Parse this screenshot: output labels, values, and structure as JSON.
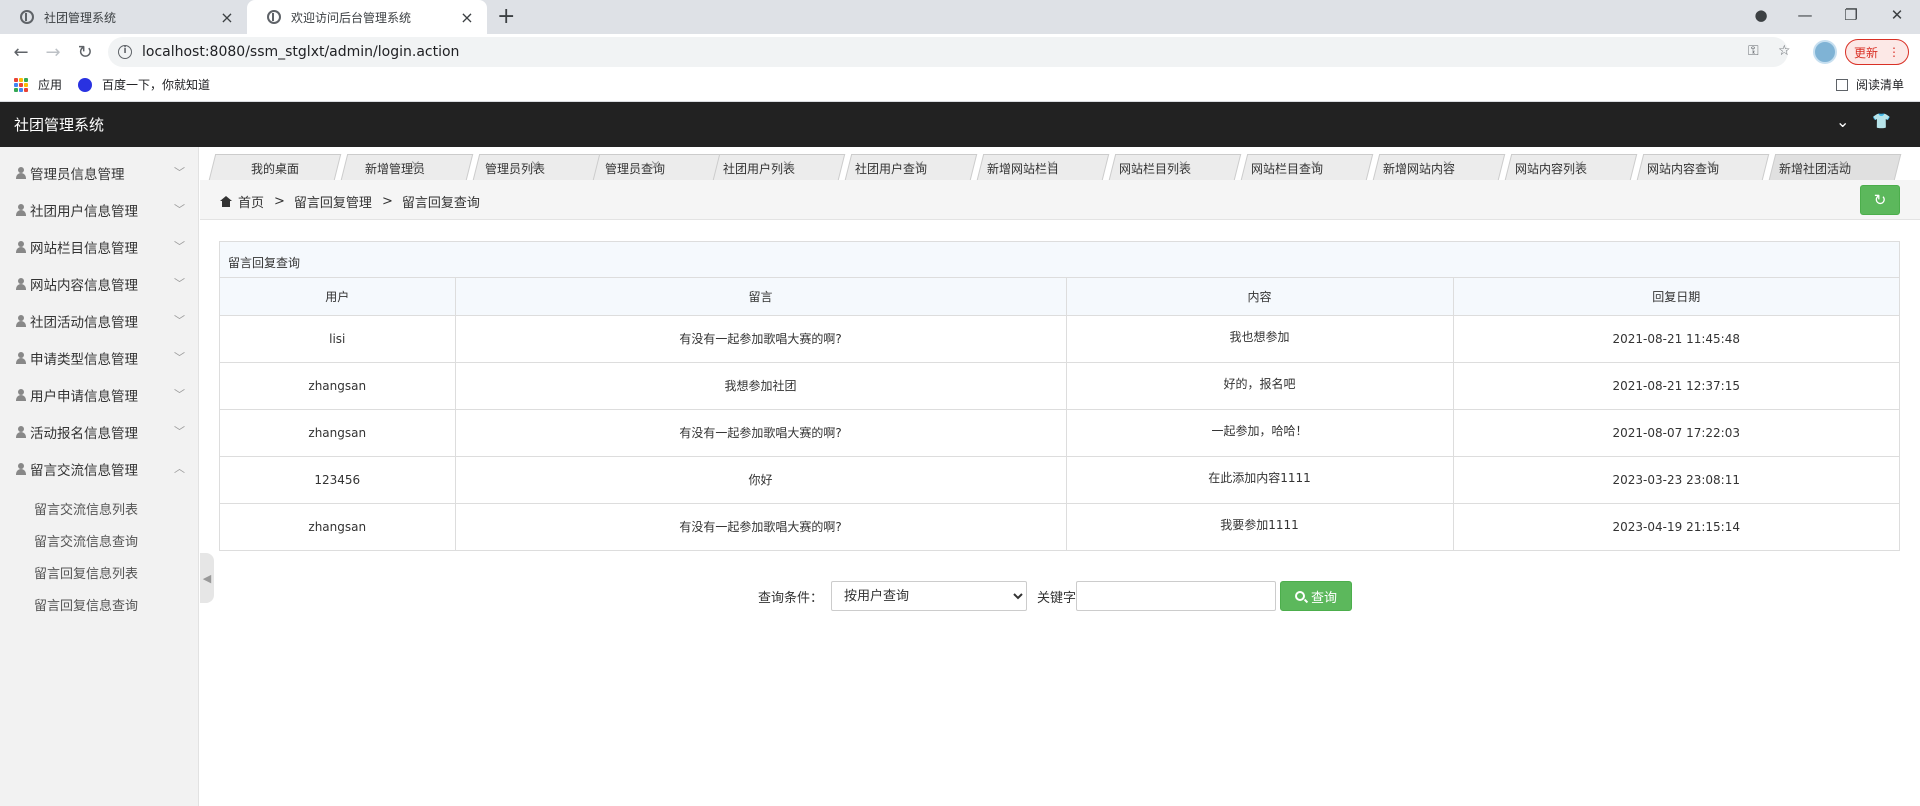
{
  "browser": {
    "tabs": [
      {
        "title": "社团管理系统"
      },
      {
        "title": "欢迎访问后台管理系统"
      }
    ],
    "url": "localhost:8080/ssm_stglxt/admin/login.action",
    "update_label": "更新",
    "bookmarks": [
      {
        "label": "应用"
      },
      {
        "label": "百度一下，你就知道"
      }
    ],
    "reading_list": "阅读清单"
  },
  "app": {
    "title": "社团管理系统"
  },
  "sidebar": {
    "items": [
      {
        "label": "管理员信息管理"
      },
      {
        "label": "社团用户信息管理"
      },
      {
        "label": "网站栏目信息管理"
      },
      {
        "label": "网站内容信息管理"
      },
      {
        "label": "社团活动信息管理"
      },
      {
        "label": "申请类型信息管理"
      },
      {
        "label": "用户申请信息管理"
      },
      {
        "label": "活动报名信息管理"
      },
      {
        "label": "留言交流信息管理"
      }
    ],
    "subitems": [
      {
        "label": "留言交流信息列表"
      },
      {
        "label": "留言交流信息查询"
      },
      {
        "label": "留言回复信息列表"
      },
      {
        "label": "留言回复信息查询"
      }
    ]
  },
  "page_tabs": [
    {
      "label": "我的桌面"
    },
    {
      "label": "新增管理员"
    },
    {
      "label": "管理员列表"
    },
    {
      "label": "管理员查询"
    },
    {
      "label": "社团用户列表"
    },
    {
      "label": "社团用户查询"
    },
    {
      "label": "新增网站栏目"
    },
    {
      "label": "网站栏目列表"
    },
    {
      "label": "网站栏目查询"
    },
    {
      "label": "新增网站内容"
    },
    {
      "label": "网站内容列表"
    },
    {
      "label": "网站内容查询"
    },
    {
      "label": "新增社团活动"
    }
  ],
  "breadcrumb": {
    "home": "首页",
    "sep": ">",
    "level1": "留言回复管理",
    "level2": "留言回复查询"
  },
  "panel": {
    "title": "留言回复查询",
    "columns": [
      "用户",
      "留言",
      "内容",
      "回复日期"
    ],
    "rows": [
      {
        "user": "lisi",
        "message": "有没有一起参加歌唱大赛的啊?",
        "content": "我也想参加",
        "date": "2021-08-21 11:45:48"
      },
      {
        "user": "zhangsan",
        "message": "我想参加社团",
        "content": "好的，报名吧",
        "date": "2021-08-21 12:37:15"
      },
      {
        "user": "zhangsan",
        "message": "有没有一起参加歌唱大赛的啊?",
        "content": "一起参加，哈哈！",
        "date": "2021-08-07 17:22:03"
      },
      {
        "user": "123456",
        "message": "你好",
        "content": "在此添加内容1111",
        "date": "2023-03-23 23:08:11"
      },
      {
        "user": "zhangsan",
        "message": "有没有一起参加歌唱大赛的啊?",
        "content": "我要参加1111",
        "date": "2023-04-19 21:15:14"
      }
    ]
  },
  "search": {
    "condition_label": "查询条件：",
    "selected_option": "按用户查询",
    "keyword_label": "关键字",
    "keyword_value": "",
    "button_label": "查询"
  },
  "colors": {
    "header_bg": "#222222",
    "accent_green": "#5cb85c",
    "update_red": "#d93025"
  }
}
